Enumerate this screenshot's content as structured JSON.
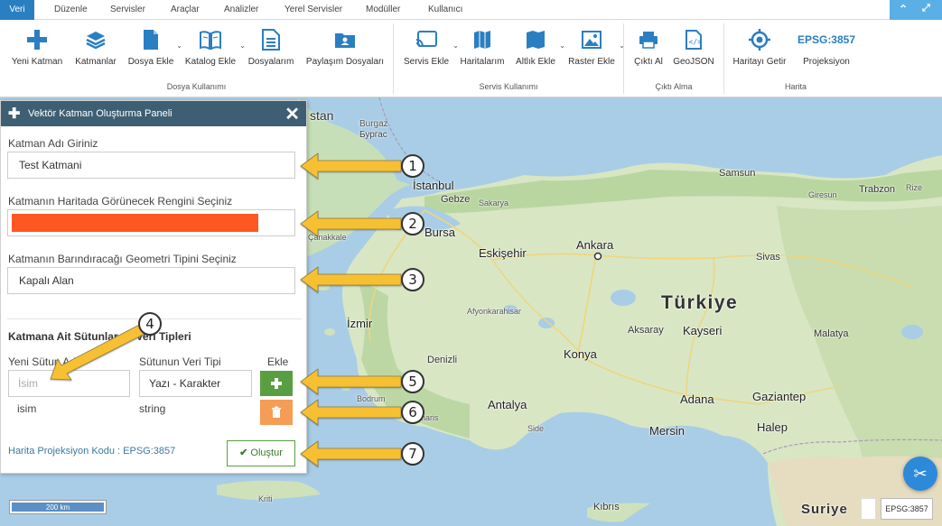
{
  "menu": {
    "tabs": [
      "Veri",
      "Düzenle",
      "Servisler",
      "Araçlar",
      "Analizler",
      "Yerel Servisler",
      "Modüller",
      "Kullanıcı"
    ],
    "active_tab": "Veri"
  },
  "ribbon": {
    "tools": {
      "new_layer": "Yeni Katman",
      "layers": "Katmanlar",
      "add_file": "Dosya Ekle",
      "add_catalog": "Katalog Ekle",
      "my_files": "Dosyalarım",
      "shared_files": "Paylaşım Dosyaları",
      "add_service": "Servis Ekle",
      "my_maps": "Haritalarım",
      "add_basemap": "Altlık Ekle",
      "add_raster": "Raster Ekle",
      "print_output": "Çıktı Al",
      "geojson": "GeoJSON",
      "get_map": "Haritayı Getir",
      "projection": "Projeksiyon",
      "projection_code": "EPSG:3857"
    },
    "groups": {
      "file_usage": "Dosya Kullanımı",
      "service_usage": "Servis Kullanımı",
      "output": "Çıktı Alma",
      "map": "Harita"
    }
  },
  "panel": {
    "title": "Vektör Katman Oluşturma Paneli",
    "layer_name_label": "Katman Adı Giriniz",
    "layer_name_value": "Test Katmani",
    "color_label": "Katmanın Haritada Görünecek Rengini Seçiniz",
    "color_value": "#ff5722",
    "geometry_label": "Katmanın Barındıracağı Geometri Tipini Seçiniz",
    "geometry_value": "Kapalı Alan",
    "columns_title": "Katmana Ait Sütunlar ve Veri Tipleri",
    "new_column_label": "Yeni Sütun Adı",
    "column_type_label": "Sütunun Veri Tipi",
    "add_label": "Ekle",
    "column_name_placeholder": "İsim",
    "column_type_value": "Yazı - Karakter",
    "existing_column_name": "isim",
    "existing_column_type": "string",
    "projection_text": "Harita Projeksiyon Kodu : EPSG:3857",
    "create_button": "Oluştur"
  },
  "callouts": [
    "1",
    "2",
    "3",
    "4",
    "5",
    "6",
    "7"
  ],
  "map": {
    "cities": {
      "istanbul": "İstanbul",
      "gebze": "Gebze",
      "sakarya": "Sakarya",
      "bursa": "Bursa",
      "eskisehir": "Eskişehir",
      "ankara": "Ankara",
      "samsun": "Samsun",
      "giresun": "Giresun",
      "trabzon": "Trabzon",
      "rize": "Rize",
      "sivas": "Sivas",
      "izmir": "İzmir",
      "afyonkarahisar": "Afyonkarahisar",
      "denizli": "Denizli",
      "konya": "Konya",
      "aksaray": "Aksaray",
      "kayseri": "Kayseri",
      "malatya": "Malatya",
      "adana": "Adana",
      "gaziantep": "Gaziantep",
      "mersin": "Mersin",
      "antalya": "Antalya",
      "side": "Side",
      "marmaris": "Marmaris",
      "bodrum": "Bodrum",
      "canakkale": "Çanakkale",
      "halep": "Halep",
      "kibris": "Kıbrıs",
      "kriti": "Kriti",
      "burgaz": "Burgaz",
      "burgaz_cyr": "Бургас",
      "stan": "stan"
    },
    "countries": {
      "turkiye": "Türkiye",
      "suriye": "Suriye"
    },
    "scale": "200 km",
    "epsg": "EPSG:3857"
  },
  "colors": {
    "accent": "#2a7fc1",
    "panel_header": "#3e5f73",
    "add_green": "#5a9e42",
    "delete_orange": "#f59d54",
    "callout_yellow": "#f7c033"
  }
}
